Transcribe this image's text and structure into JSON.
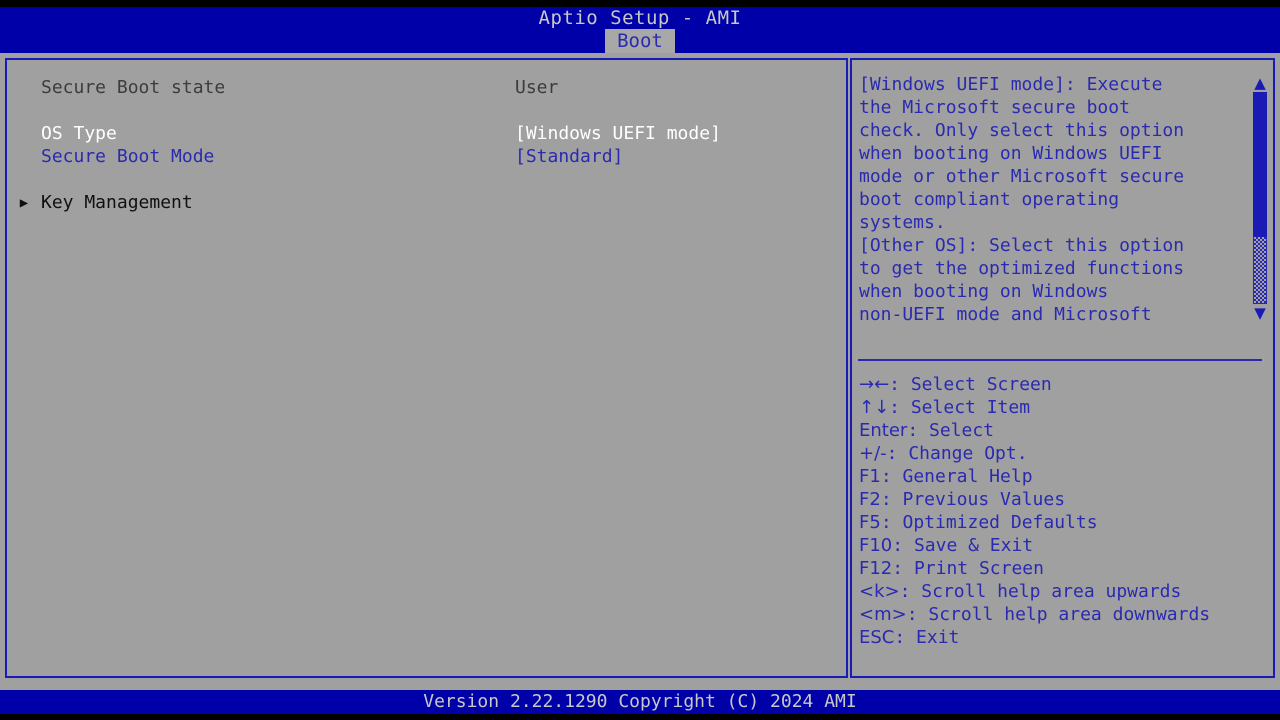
{
  "header": {
    "title": "Aptio Setup - AMI",
    "tabs": [
      {
        "label": "Boot",
        "active": true
      }
    ]
  },
  "settings": [
    {
      "arrow": "",
      "label": "Secure Boot state",
      "value": "User",
      "style": "readonly"
    },
    {
      "arrow": "",
      "label": "",
      "value": "",
      "style": "spacer"
    },
    {
      "arrow": "",
      "label": "OS Type",
      "value": "[Windows UEFI mode]",
      "style": "selected"
    },
    {
      "arrow": "",
      "label": "Secure Boot Mode",
      "value": "[Standard]",
      "style": "normal"
    },
    {
      "arrow": "",
      "label": "",
      "value": "",
      "style": "spacer"
    },
    {
      "arrow": "▶",
      "label": "Key Management",
      "value": "",
      "style": "submenu"
    }
  ],
  "help": {
    "text": "[Windows UEFI mode]: Execute\nthe Microsoft secure boot\ncheck. Only select this option\nwhen booting on Windows UEFI\nmode or other Microsoft secure\nboot compliant operating\nsystems.\n[Other OS]: Select this option\nto get the optimized functions\nwhen booting on Windows\nnon-UEFI mode and Microsoft",
    "scrollbar": {
      "up_arrow": "▲",
      "down_arrow": "▼"
    }
  },
  "legend": [
    {
      "keys": "→←",
      "text": ": Select Screen"
    },
    {
      "keys": "↑↓",
      "text": ": Select Item"
    },
    {
      "keys": "Enter",
      "text": ": Select"
    },
    {
      "keys": "+/-",
      "text": ": Change Opt."
    },
    {
      "keys": "F1",
      "text": ": General Help"
    },
    {
      "keys": "F2",
      "text": ": Previous Values"
    },
    {
      "keys": "F5",
      "text": ": Optimized Defaults"
    },
    {
      "keys": "F10",
      "text": ": Save & Exit"
    },
    {
      "keys": "F12",
      "text": ": Print Screen"
    },
    {
      "keys": "<k>",
      "text": ": Scroll help area upwards"
    },
    {
      "keys": "<m>",
      "text": ": Scroll help area downwards"
    },
    {
      "keys": "ESC",
      "text": ": Exit"
    }
  ],
  "footer": {
    "version": "Version 2.22.1290 Copyright (C) 2024 AMI"
  },
  "colors": {
    "header_blue": "#0000a8",
    "panel_gray": "#a0a0a0",
    "border_blue": "#1a1ab4",
    "text_blue": "#2a2ab0",
    "text_white": "#ffffff",
    "text_readonly": "#3c3c3c",
    "footer_text": "#c8c8c8"
  }
}
